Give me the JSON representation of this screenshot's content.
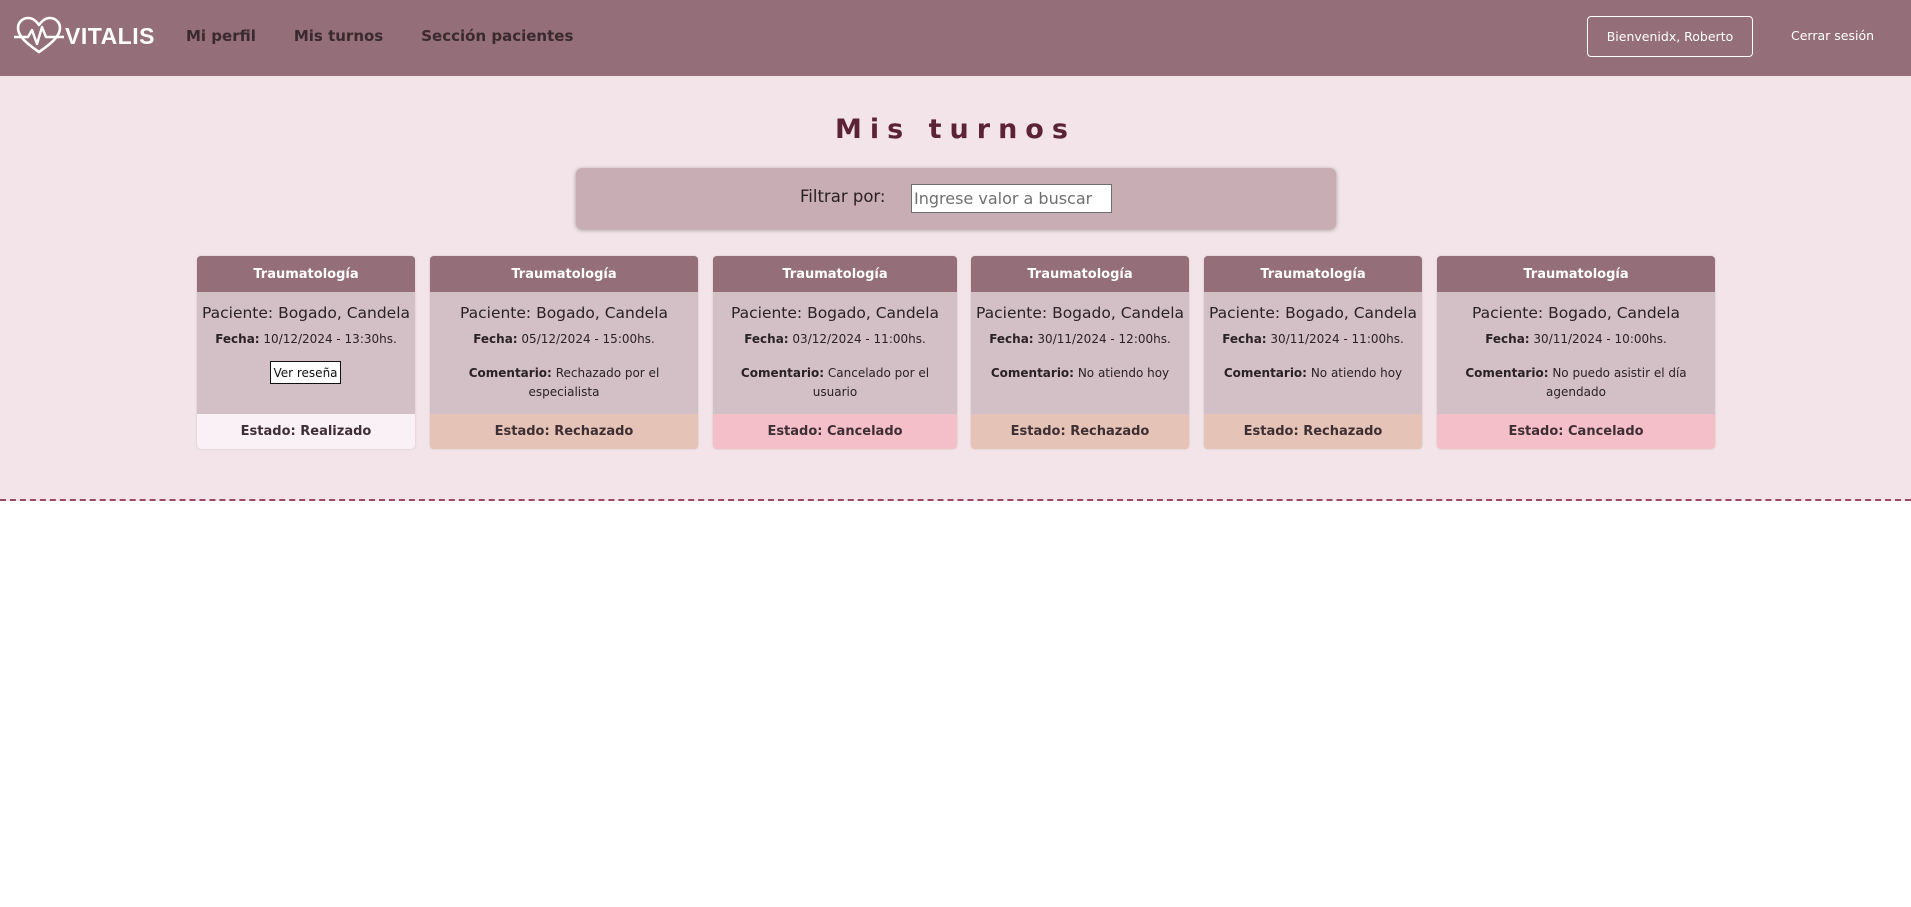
{
  "brand": {
    "name": "VITALIS",
    "icon": "heart-pulse-icon"
  },
  "nav": {
    "links": [
      "Mi perfil",
      "Mis turnos",
      "Sección pacientes"
    ],
    "welcome": "Bienvenidx, Roberto",
    "logout": "Cerrar sesión"
  },
  "page": {
    "title": "Mis turnos"
  },
  "filter": {
    "label": "Filtrar por:",
    "placeholder": "Ingrese valor a buscar"
  },
  "labels": {
    "fecha": "Fecha:",
    "comentario": "Comentario:"
  },
  "cards": [
    {
      "specialty": "Traumatología",
      "patient": "Paciente: Bogado, Candela",
      "date": "10/12/2024 - 13:30hs.",
      "comment": "",
      "action": "Ver reseña",
      "status": "Estado: Realizado",
      "status_color": "#faf1f6"
    },
    {
      "specialty": "Traumatología",
      "patient": "Paciente: Bogado, Candela",
      "date": "05/12/2024 - 15:00hs.",
      "comment": "Rechazado por el especialista",
      "action": "",
      "status": "Estado: Rechazado",
      "status_color": "#e5c3b6"
    },
    {
      "specialty": "Traumatología",
      "patient": "Paciente: Bogado, Candela",
      "date": "03/12/2024 - 11:00hs.",
      "comment": "Cancelado por el usuario",
      "action": "",
      "status": "Estado: Cancelado",
      "status_color": "#f5bfc9"
    },
    {
      "specialty": "Traumatología",
      "patient": "Paciente: Bogado, Candela",
      "date": "30/11/2024 - 12:00hs.",
      "comment": "No atiendo hoy",
      "action": "",
      "status": "Estado: Rechazado",
      "status_color": "#e5c3b6"
    },
    {
      "specialty": "Traumatología",
      "patient": "Paciente: Bogado, Candela",
      "date": "30/11/2024 - 11:00hs.",
      "comment": "No atiendo hoy",
      "action": "",
      "status": "Estado: Rechazado",
      "status_color": "#e5c3b6"
    },
    {
      "specialty": "Traumatología",
      "patient": "Paciente: Bogado, Candela",
      "date": "30/11/2024 - 10:00hs.",
      "comment": "No puedo asistir el día agendado",
      "action": "",
      "status": "Estado: Cancelado",
      "status_color": "#f5bfc9"
    }
  ],
  "colors": {
    "navbar": "#946e79",
    "background": "#f3e4e9",
    "filter_bg": "#c9adb5",
    "card_body": "#d3c0c6",
    "title": "#5c2236"
  }
}
